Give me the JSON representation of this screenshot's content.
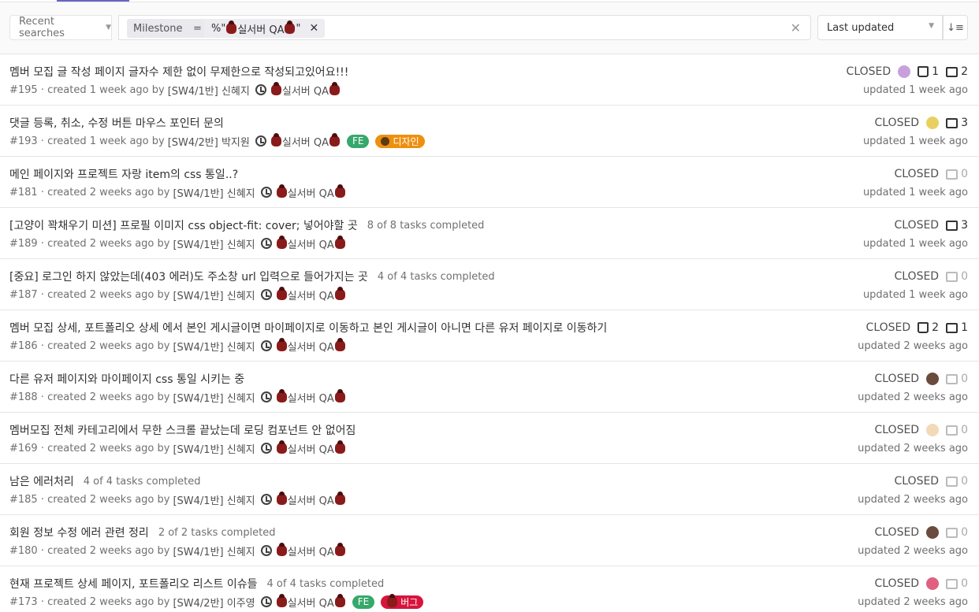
{
  "filter": {
    "recent_label": "Recent searches",
    "token_name": "Milestone",
    "token_op": "=",
    "token_value_prefix": "%\"",
    "token_value_text": "실서버 QA",
    "token_value_suffix": "\"",
    "sort_label": "Last updated"
  },
  "colors": {
    "accent": "#6666c4",
    "label_fe": "#36a86b",
    "label_design": "#ef8f0e",
    "label_bug": "#d7143c"
  },
  "milestone_name": "실서버 QA",
  "issues": [
    {
      "title": "멤버 모집 글 작성 페이지 글자수 제한 없이 무제한으로 작성되고있어요!!!",
      "tasks": "",
      "meta": "#195 · created 1 week ago by",
      "author": "[SW4/1반] 신혜지",
      "labels": [],
      "status": "CLOSED",
      "avatar": "#c9a0dc",
      "upvotes": "1",
      "comments": "2",
      "updated": "updated 1 week ago"
    },
    {
      "title": "댓글 등록, 취소, 수정 버튼 마우스 포인터 문의",
      "tasks": "",
      "meta": "#193 · created 1 week ago by",
      "author": "[SW4/2반] 박지원",
      "labels": [
        "FE",
        "디자인"
      ],
      "status": "CLOSED",
      "avatar": "#e8d060",
      "upvotes": "",
      "comments": "3",
      "updated": "updated 1 week ago"
    },
    {
      "title": "메인 페이지와 프로젝트 자랑 item의 css 통일..?",
      "tasks": "",
      "meta": "#181 · created 2 weeks ago by",
      "author": "[SW4/1반] 신혜지",
      "labels": [],
      "status": "CLOSED",
      "avatar": "",
      "upvotes": "",
      "comments": "0",
      "updated": "updated 1 week ago"
    },
    {
      "title": "[고양이 꽉채우기 미션] 프로필 이미지 css object-fit: cover; 넣어야할 곳",
      "tasks": "8 of 8 tasks completed",
      "meta": "#189 · created 2 weeks ago by",
      "author": "[SW4/1반] 신혜지",
      "labels": [],
      "status": "CLOSED",
      "avatar": "",
      "upvotes": "",
      "comments": "3",
      "updated": "updated 1 week ago"
    },
    {
      "title": "[중요] 로그인 하지 않았는데(403 에러)도 주소창 url 입력으로 들어가지는 곳",
      "tasks": "4 of 4 tasks completed",
      "meta": "#187 · created 2 weeks ago by",
      "author": "[SW4/1반] 신혜지",
      "labels": [],
      "status": "CLOSED",
      "avatar": "",
      "upvotes": "",
      "comments": "0",
      "updated": "updated 1 week ago"
    },
    {
      "title": "멤버 모집 상세, 포트폴리오 상세 에서 본인 게시글이면 마이페이지로 이동하고 본인 게시글이 아니면 다른 유저 페이지로 이동하기",
      "tasks": "",
      "meta": "#186 · created 2 weeks ago by",
      "author": "[SW4/1반] 신혜지",
      "labels": [],
      "status": "CLOSED",
      "avatar": "",
      "upvotes": "2",
      "comments": "1",
      "updated": "updated 2 weeks ago"
    },
    {
      "title": "다른 유저 페이지와 마이페이지 css 통일 시키는 중",
      "tasks": "",
      "meta": "#188 · created 2 weeks ago by",
      "author": "[SW4/1반] 신혜지",
      "labels": [],
      "status": "CLOSED",
      "avatar": "#6b4b3e",
      "upvotes": "",
      "comments": "0",
      "updated": "updated 2 weeks ago"
    },
    {
      "title": "멤버모집 전체 카테고리에서 무한 스크롤 끝났는데 로딩 컴포넌트 안 없어짐",
      "tasks": "",
      "meta": "#169 · created 2 weeks ago by",
      "author": "[SW4/1반] 신혜지",
      "labels": [],
      "status": "CLOSED",
      "avatar": "#f3d9b8",
      "upvotes": "",
      "comments": "0",
      "updated": "updated 2 weeks ago"
    },
    {
      "title": "남은 에러처리",
      "tasks": "4 of 4 tasks completed",
      "meta": "#185 · created 2 weeks ago by",
      "author": "[SW4/1반] 신혜지",
      "labels": [],
      "status": "CLOSED",
      "avatar": "",
      "upvotes": "",
      "comments": "0",
      "updated": "updated 2 weeks ago"
    },
    {
      "title": "회원 정보 수정 에러 관련 정리",
      "tasks": "2 of 2 tasks completed",
      "meta": "#180 · created 2 weeks ago by",
      "author": "[SW4/1반] 신혜지",
      "labels": [],
      "status": "CLOSED",
      "avatar": "#6b4b3e",
      "upvotes": "",
      "comments": "0",
      "updated": "updated 2 weeks ago"
    },
    {
      "title": "현재 프로젝트 상세 페이지, 포트폴리오 리스트 이슈들",
      "tasks": "4 of 4 tasks completed",
      "meta": "#173 · created 2 weeks ago by",
      "author": "[SW4/2반] 이주영",
      "labels": [
        "FE",
        "버그"
      ],
      "status": "CLOSED",
      "avatar": "#e06080",
      "upvotes": "",
      "comments": "0",
      "updated": "updated 2 weeks ago"
    }
  ]
}
